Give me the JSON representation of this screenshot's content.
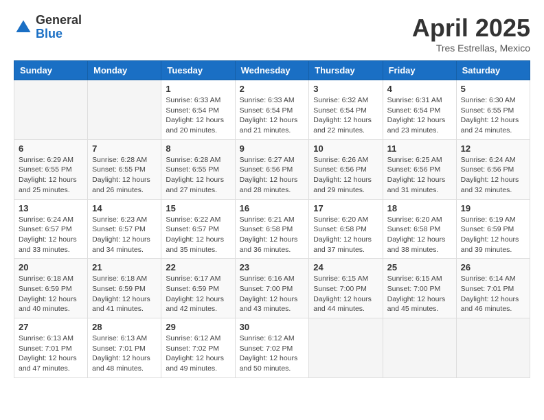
{
  "logo": {
    "general": "General",
    "blue": "Blue"
  },
  "header": {
    "title": "April 2025",
    "location": "Tres Estrellas, Mexico"
  },
  "days_of_week": [
    "Sunday",
    "Monday",
    "Tuesday",
    "Wednesday",
    "Thursday",
    "Friday",
    "Saturday"
  ],
  "weeks": [
    [
      {
        "day": "",
        "info": ""
      },
      {
        "day": "",
        "info": ""
      },
      {
        "day": "1",
        "info": "Sunrise: 6:33 AM\nSunset: 6:54 PM\nDaylight: 12 hours and 20 minutes."
      },
      {
        "day": "2",
        "info": "Sunrise: 6:33 AM\nSunset: 6:54 PM\nDaylight: 12 hours and 21 minutes."
      },
      {
        "day": "3",
        "info": "Sunrise: 6:32 AM\nSunset: 6:54 PM\nDaylight: 12 hours and 22 minutes."
      },
      {
        "day": "4",
        "info": "Sunrise: 6:31 AM\nSunset: 6:54 PM\nDaylight: 12 hours and 23 minutes."
      },
      {
        "day": "5",
        "info": "Sunrise: 6:30 AM\nSunset: 6:55 PM\nDaylight: 12 hours and 24 minutes."
      }
    ],
    [
      {
        "day": "6",
        "info": "Sunrise: 6:29 AM\nSunset: 6:55 PM\nDaylight: 12 hours and 25 minutes."
      },
      {
        "day": "7",
        "info": "Sunrise: 6:28 AM\nSunset: 6:55 PM\nDaylight: 12 hours and 26 minutes."
      },
      {
        "day": "8",
        "info": "Sunrise: 6:28 AM\nSunset: 6:55 PM\nDaylight: 12 hours and 27 minutes."
      },
      {
        "day": "9",
        "info": "Sunrise: 6:27 AM\nSunset: 6:56 PM\nDaylight: 12 hours and 28 minutes."
      },
      {
        "day": "10",
        "info": "Sunrise: 6:26 AM\nSunset: 6:56 PM\nDaylight: 12 hours and 29 minutes."
      },
      {
        "day": "11",
        "info": "Sunrise: 6:25 AM\nSunset: 6:56 PM\nDaylight: 12 hours and 31 minutes."
      },
      {
        "day": "12",
        "info": "Sunrise: 6:24 AM\nSunset: 6:56 PM\nDaylight: 12 hours and 32 minutes."
      }
    ],
    [
      {
        "day": "13",
        "info": "Sunrise: 6:24 AM\nSunset: 6:57 PM\nDaylight: 12 hours and 33 minutes."
      },
      {
        "day": "14",
        "info": "Sunrise: 6:23 AM\nSunset: 6:57 PM\nDaylight: 12 hours and 34 minutes."
      },
      {
        "day": "15",
        "info": "Sunrise: 6:22 AM\nSunset: 6:57 PM\nDaylight: 12 hours and 35 minutes."
      },
      {
        "day": "16",
        "info": "Sunrise: 6:21 AM\nSunset: 6:58 PM\nDaylight: 12 hours and 36 minutes."
      },
      {
        "day": "17",
        "info": "Sunrise: 6:20 AM\nSunset: 6:58 PM\nDaylight: 12 hours and 37 minutes."
      },
      {
        "day": "18",
        "info": "Sunrise: 6:20 AM\nSunset: 6:58 PM\nDaylight: 12 hours and 38 minutes."
      },
      {
        "day": "19",
        "info": "Sunrise: 6:19 AM\nSunset: 6:59 PM\nDaylight: 12 hours and 39 minutes."
      }
    ],
    [
      {
        "day": "20",
        "info": "Sunrise: 6:18 AM\nSunset: 6:59 PM\nDaylight: 12 hours and 40 minutes."
      },
      {
        "day": "21",
        "info": "Sunrise: 6:18 AM\nSunset: 6:59 PM\nDaylight: 12 hours and 41 minutes."
      },
      {
        "day": "22",
        "info": "Sunrise: 6:17 AM\nSunset: 6:59 PM\nDaylight: 12 hours and 42 minutes."
      },
      {
        "day": "23",
        "info": "Sunrise: 6:16 AM\nSunset: 7:00 PM\nDaylight: 12 hours and 43 minutes."
      },
      {
        "day": "24",
        "info": "Sunrise: 6:15 AM\nSunset: 7:00 PM\nDaylight: 12 hours and 44 minutes."
      },
      {
        "day": "25",
        "info": "Sunrise: 6:15 AM\nSunset: 7:00 PM\nDaylight: 12 hours and 45 minutes."
      },
      {
        "day": "26",
        "info": "Sunrise: 6:14 AM\nSunset: 7:01 PM\nDaylight: 12 hours and 46 minutes."
      }
    ],
    [
      {
        "day": "27",
        "info": "Sunrise: 6:13 AM\nSunset: 7:01 PM\nDaylight: 12 hours and 47 minutes."
      },
      {
        "day": "28",
        "info": "Sunrise: 6:13 AM\nSunset: 7:01 PM\nDaylight: 12 hours and 48 minutes."
      },
      {
        "day": "29",
        "info": "Sunrise: 6:12 AM\nSunset: 7:02 PM\nDaylight: 12 hours and 49 minutes."
      },
      {
        "day": "30",
        "info": "Sunrise: 6:12 AM\nSunset: 7:02 PM\nDaylight: 12 hours and 50 minutes."
      },
      {
        "day": "",
        "info": ""
      },
      {
        "day": "",
        "info": ""
      },
      {
        "day": "",
        "info": ""
      }
    ]
  ]
}
